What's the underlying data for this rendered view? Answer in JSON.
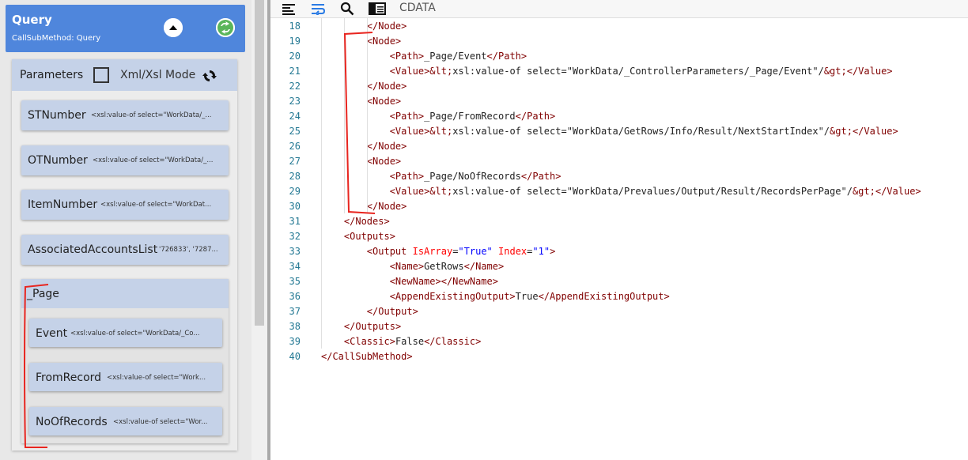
{
  "query": {
    "title": "Query",
    "subtitle": "CallSubMethod: Query"
  },
  "params": {
    "title": "Parameters",
    "mode_label": "Xml/Xsl Mode",
    "items": [
      {
        "name": "STNumber",
        "value": "<xsl:value-of select=\"WorkData/_..."
      },
      {
        "name": "OTNumber",
        "value": "<xsl:value-of select=\"WorkData/_..."
      },
      {
        "name": "ItemNumber",
        "value": "<xsl:value-of select=\"WorkDat..."
      },
      {
        "name": "AssociatedAccountsList",
        "value": "'726833', '7287..."
      }
    ],
    "group": {
      "title": "_Page",
      "items": [
        {
          "name": "Event",
          "value": "<xsl:value-of select=\"WorkData/_Co..."
        },
        {
          "name": "FromRecord",
          "value": "<xsl:value-of select=\"Work..."
        },
        {
          "name": "NoOfRecords",
          "value": "<xsl:value-of select=\"Wor..."
        }
      ]
    }
  },
  "toolbar": {
    "icons": [
      "align-left-icon",
      "wrap-icon",
      "search-icon",
      "panel-icon"
    ],
    "cdata_label": "CDATA"
  },
  "editor": {
    "lines": [
      {
        "n": "18",
        "text": "        </Node>"
      },
      {
        "n": "19",
        "text": "        <Node>"
      },
      {
        "n": "20",
        "text": "            <Path>_Page/Event</Path>"
      },
      {
        "n": "21",
        "text": "            <Value>&lt;xsl:value-of select=\"WorkData/_ControllerParameters/_Page/Event\"/&gt;</Value>"
      },
      {
        "n": "22",
        "text": "        </Node>"
      },
      {
        "n": "23",
        "text": "        <Node>"
      },
      {
        "n": "24",
        "text": "            <Path>_Page/FromRecord</Path>"
      },
      {
        "n": "25",
        "text": "            <Value>&lt;xsl:value-of select=\"WorkData/GetRows/Info/Result/NextStartIndex\"/&gt;</Value>"
      },
      {
        "n": "26",
        "text": "        </Node>"
      },
      {
        "n": "27",
        "text": "        <Node>"
      },
      {
        "n": "28",
        "text": "            <Path>_Page/NoOfRecords</Path>"
      },
      {
        "n": "29",
        "text": "            <Value>&lt;xsl:value-of select=\"WorkData/Prevalues/Output/Result/RecordsPerPage\"/&gt;</Value>"
      },
      {
        "n": "30",
        "text": "        </Node>"
      },
      {
        "n": "31",
        "text": "    </Nodes>"
      },
      {
        "n": "32",
        "text": "    <Outputs>"
      },
      {
        "n": "33",
        "text": "        <Output IsArray=\"True\" Index=\"1\">"
      },
      {
        "n": "34",
        "text": "            <Name>GetRows</Name>"
      },
      {
        "n": "35",
        "text": "            <NewName></NewName>"
      },
      {
        "n": "36",
        "text": "            <AppendExistingOutput>True</AppendExistingOutput>"
      },
      {
        "n": "37",
        "text": "        </Output>"
      },
      {
        "n": "38",
        "text": "    </Outputs>"
      },
      {
        "n": "39",
        "text": "    <Classic>False</Classic>"
      },
      {
        "n": "40",
        "text": "</CallSubMethod>"
      }
    ]
  },
  "colors": {
    "header_blue": "#4f86dc",
    "card_blue": "#c5d2e8",
    "tag": "#800000",
    "attr": "#ff0000",
    "value": "#0000ff",
    "line_number": "#237893",
    "annotation": "#e8251f"
  }
}
